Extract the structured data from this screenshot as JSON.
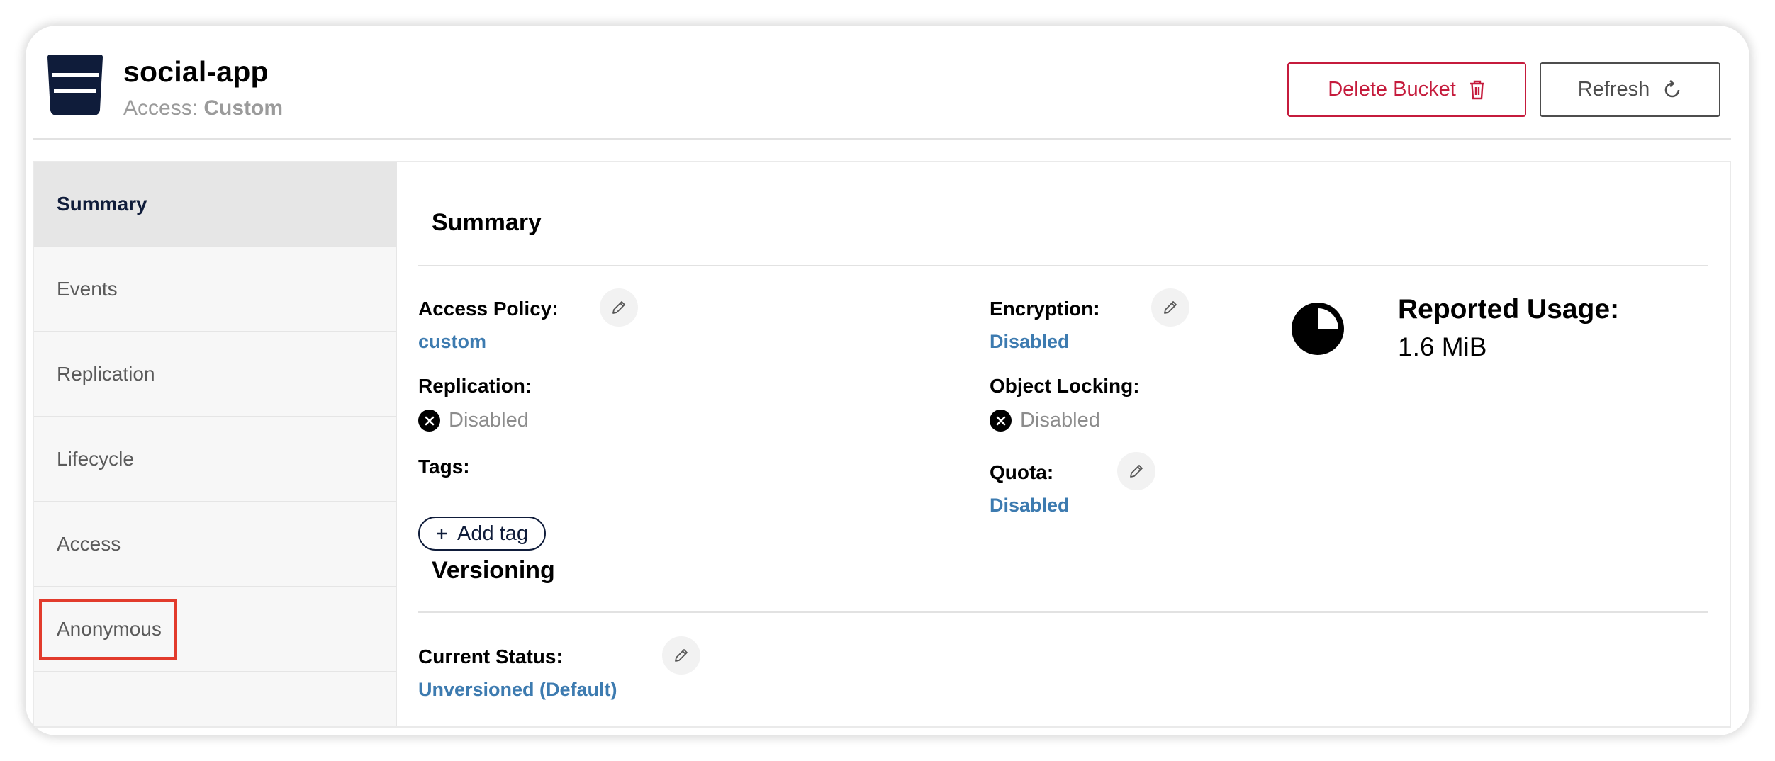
{
  "header": {
    "bucket_name": "social-app",
    "access_label": "Access:",
    "access_value": "Custom",
    "delete_label": "Delete Bucket",
    "refresh_label": "Refresh"
  },
  "sidebar": {
    "items": [
      {
        "label": "Summary",
        "active": true
      },
      {
        "label": "Events"
      },
      {
        "label": "Replication"
      },
      {
        "label": "Lifecycle"
      },
      {
        "label": "Access"
      },
      {
        "label": "Anonymous",
        "highlighted": true
      }
    ]
  },
  "summary": {
    "title": "Summary",
    "access_policy_label": "Access Policy:",
    "access_policy_value": "custom",
    "encryption_label": "Encryption:",
    "encryption_value": "Disabled",
    "replication_label": "Replication:",
    "replication_value": "Disabled",
    "object_locking_label": "Object Locking:",
    "object_locking_value": "Disabled",
    "tags_label": "Tags:",
    "add_tag_label": "Add tag",
    "quota_label": "Quota:",
    "quota_value": "Disabled",
    "usage_title": "Reported Usage:",
    "usage_value": "1.6 MiB"
  },
  "versioning": {
    "title": "Versioning",
    "status_label": "Current Status:",
    "status_value": "Unversioned (Default)"
  },
  "icons": {
    "bucket": "bucket-icon",
    "delete": "trash-icon",
    "refresh": "refresh-icon",
    "edit": "pencil-icon",
    "disabled": "x-circle-icon",
    "usage": "pie-chart-icon",
    "add": "plus-icon"
  },
  "colors": {
    "danger": "#c51b3c",
    "link": "#3d7bb0",
    "navy": "#0f1c3a",
    "highlight": "#e23b2c"
  }
}
